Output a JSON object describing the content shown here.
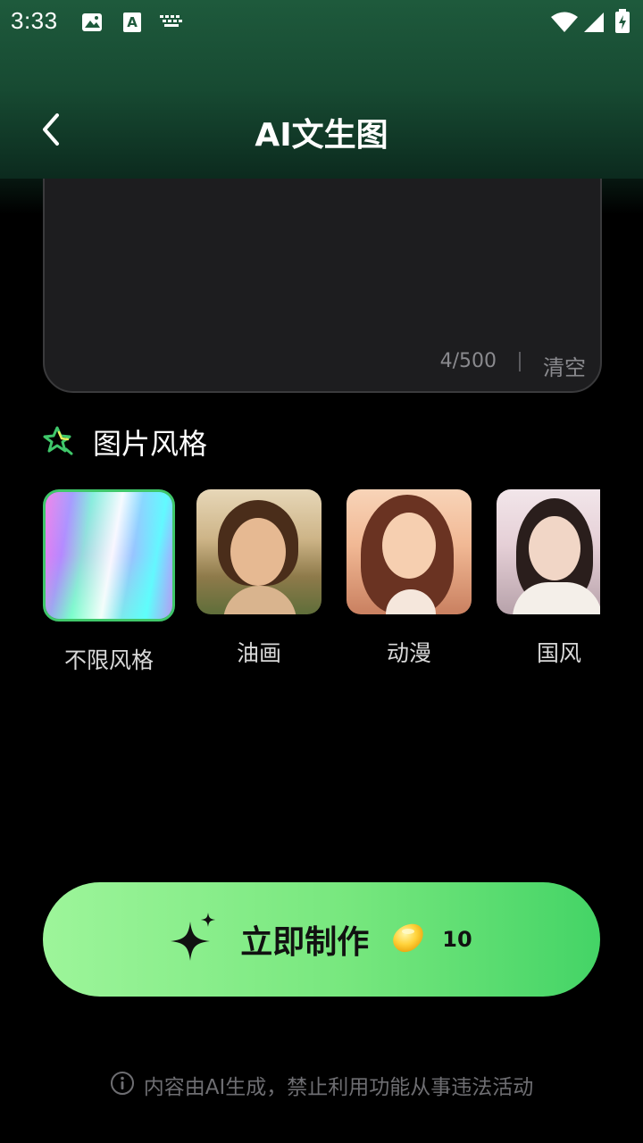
{
  "status_bar": {
    "time": "3:33"
  },
  "header": {
    "title": "AI文生图"
  },
  "prompt": {
    "counter": "4/500",
    "clear_label": "清空"
  },
  "style_section": {
    "title": "图片风格",
    "items": [
      {
        "label": "不限风格",
        "selected": true
      },
      {
        "label": "油画",
        "selected": false
      },
      {
        "label": "动漫",
        "selected": false
      },
      {
        "label": "国风",
        "selected": false
      }
    ]
  },
  "cta": {
    "label": "立即制作",
    "cost": "10"
  },
  "disclaimer": {
    "text": "内容由AI生成，禁止利用功能从事违法活动"
  },
  "colors": {
    "accent": "#3fc76a",
    "button_start": "#9df59a",
    "button_end": "#44d466"
  }
}
